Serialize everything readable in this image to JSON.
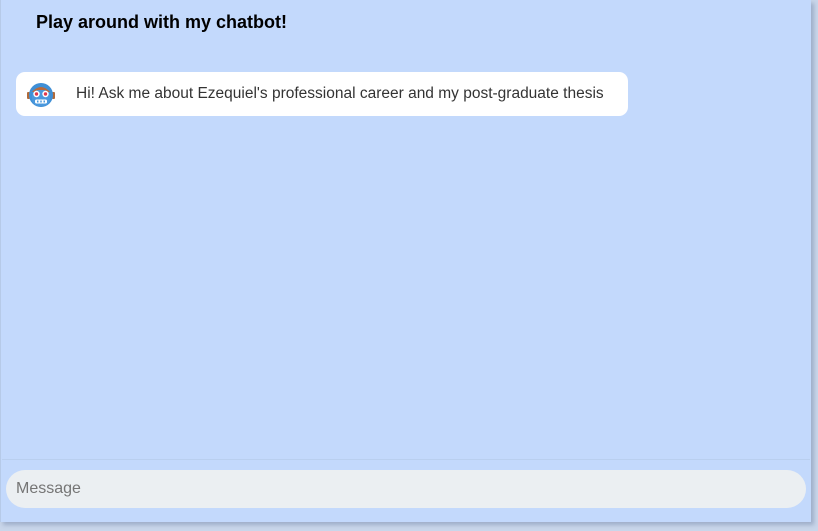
{
  "header": {
    "title": "Play around with my chatbot!"
  },
  "chat": {
    "messages": [
      {
        "sender": "bot",
        "avatar_icon": "robot-icon",
        "text": "Hi! Ask me about Ezequiel's professional career and my post-graduate thesis"
      }
    ]
  },
  "composer": {
    "value": "",
    "placeholder": "Message"
  },
  "colors": {
    "panel_background": "#c3d9fc",
    "bubble_background": "#ffffff",
    "input_background": "#ebeff2"
  }
}
